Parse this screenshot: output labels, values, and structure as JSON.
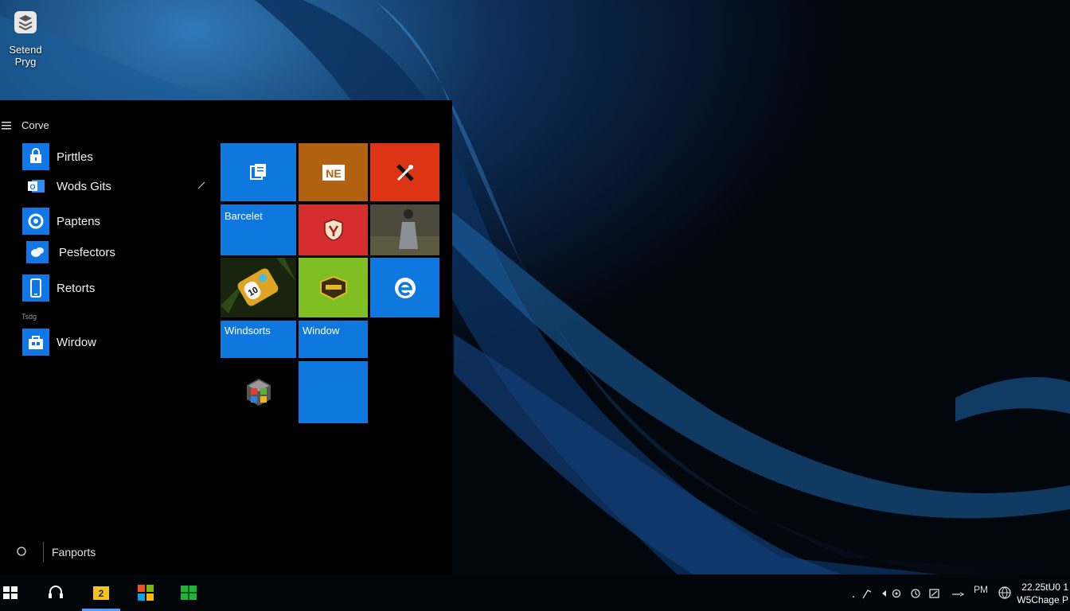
{
  "desktop": {
    "icon_label": "Setend\nPryg",
    "icon": "stack-icon"
  },
  "start_menu": {
    "title": "Corve",
    "apps": [
      {
        "label": "Pirttles",
        "icon": "lock-bag-icon"
      },
      {
        "label": "Wods Gits",
        "icon": "outlook-icon"
      },
      {
        "label": "Paptens",
        "icon": "gear-circle-icon"
      },
      {
        "label": "Pesfectors",
        "icon": "photos-icon"
      },
      {
        "label": "Retorts",
        "icon": "phone-icon"
      },
      {
        "label": "Wirdow",
        "icon": "store-bag-icon"
      }
    ],
    "section_letter": "Tsdg",
    "bottom_label": "Fanports",
    "tiles": [
      {
        "label": "",
        "color": "#0f78df",
        "icon": "files-icon"
      },
      {
        "label": "",
        "color": "#b06210",
        "icon": "onenote-icon"
      },
      {
        "label": "",
        "color": "#dc3414",
        "icon": "tools-icon"
      },
      {
        "label": "Barcelet",
        "color": "#0f78df",
        "icon": ""
      },
      {
        "label": "",
        "color": "#d62e2e",
        "icon": "shield-deer-icon"
      },
      {
        "label": "",
        "color": "#3d3a30",
        "icon": "photo-person-icon"
      },
      {
        "label": "",
        "color": "#1f2b12",
        "icon": "game-can-icon"
      },
      {
        "label": "",
        "color": "#7fbf24",
        "icon": "game-badge-icon"
      },
      {
        "label": "",
        "color": "#0f78df",
        "icon": "edge-icon"
      },
      {
        "label": "Windsorts",
        "color": "#0f78df",
        "icon": ""
      },
      {
        "label": "Window",
        "color": "#0f78df",
        "icon": ""
      },
      {
        "label": "",
        "color": "#000000",
        "icon": "cube-icon"
      },
      {
        "label": "",
        "color": "#0f78df",
        "icon": ""
      }
    ]
  },
  "taskbar": {
    "tray_text": "PM",
    "clock_time": "22.25tU0 1",
    "clock_date": "W5Chage P"
  }
}
